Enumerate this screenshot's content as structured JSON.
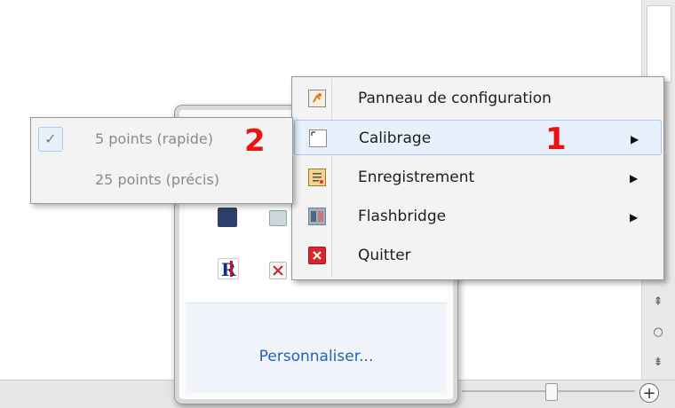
{
  "context_menu": {
    "items": [
      {
        "label": "Panneau de configuration",
        "icon": "control-panel-icon",
        "has_submenu": false
      },
      {
        "label": "Calibrage",
        "icon": "calibration-icon",
        "has_submenu": true,
        "highlighted": true
      },
      {
        "label": "Enregistrement",
        "icon": "recording-icon",
        "has_submenu": true
      },
      {
        "label": "Flashbridge",
        "icon": "flashbridge-icon",
        "has_submenu": true
      },
      {
        "label": "Quitter",
        "icon": "quit-icon",
        "has_submenu": false
      }
    ],
    "submenu_arrow": "▶"
  },
  "calibration_submenu": {
    "items": [
      {
        "label": "5 points (rapide)",
        "checked": true
      },
      {
        "label": "25 points (précis)",
        "checked": false
      }
    ],
    "check_glyph": "✓"
  },
  "tray_overflow": {
    "customize_label": "Personnaliser..."
  },
  "annotations": {
    "callout_1": "1",
    "callout_2": "2"
  },
  "scrollbar": {
    "up_glyph": "⇞",
    "mid_glyph": "○",
    "down_glyph": "⇟"
  },
  "zoom": {
    "plus_glyph": "+"
  },
  "colors": {
    "highlight": "#e8f1fb",
    "highlight_border": "#a9c9ee",
    "link": "#1f62b6",
    "callout": "#ee1111"
  }
}
